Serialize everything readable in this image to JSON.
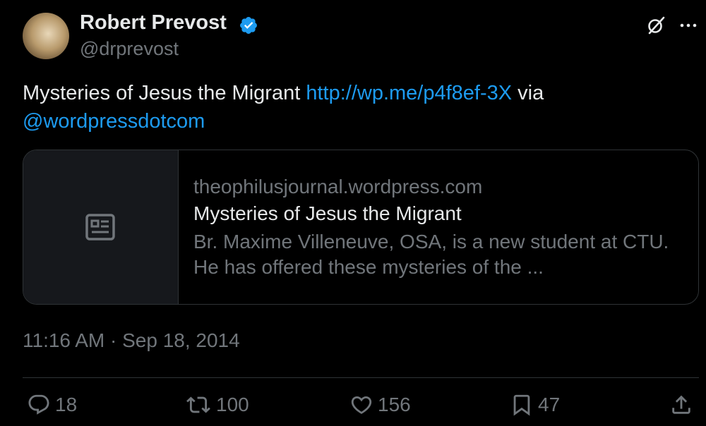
{
  "author": {
    "name": "Robert Prevost",
    "handle": "@drprevost"
  },
  "tweet": {
    "text_before": "Mysteries of Jesus the Migrant ",
    "link": "http://wp.me/p4f8ef-3X",
    "text_middle": " via",
    "mention": "@wordpressdotcom"
  },
  "card": {
    "domain": "theophilusjournal.wordpress.com",
    "title": "Mysteries of Jesus the Migrant",
    "description": "Br. Maxime Villeneuve, OSA, is a new student at CTU. He has offered these mysteries of the ..."
  },
  "timestamp": "11:16 AM · Sep 18, 2014",
  "actions": {
    "replies": "18",
    "reposts": "100",
    "likes": "156",
    "bookmarks": "47"
  },
  "icons": {
    "verified": "verified-badge-icon",
    "grok": "grok-icon",
    "more": "more-icon",
    "article": "article-icon",
    "reply": "reply-icon",
    "repost": "repost-icon",
    "like": "heart-icon",
    "bookmark": "bookmark-icon",
    "share": "share-icon"
  },
  "colors": {
    "background": "#000000",
    "primary_text": "#e7e9ea",
    "secondary_text": "#71767b",
    "link": "#1d9bf0",
    "verified": "#1d9bf0",
    "border": "#2f3336"
  }
}
